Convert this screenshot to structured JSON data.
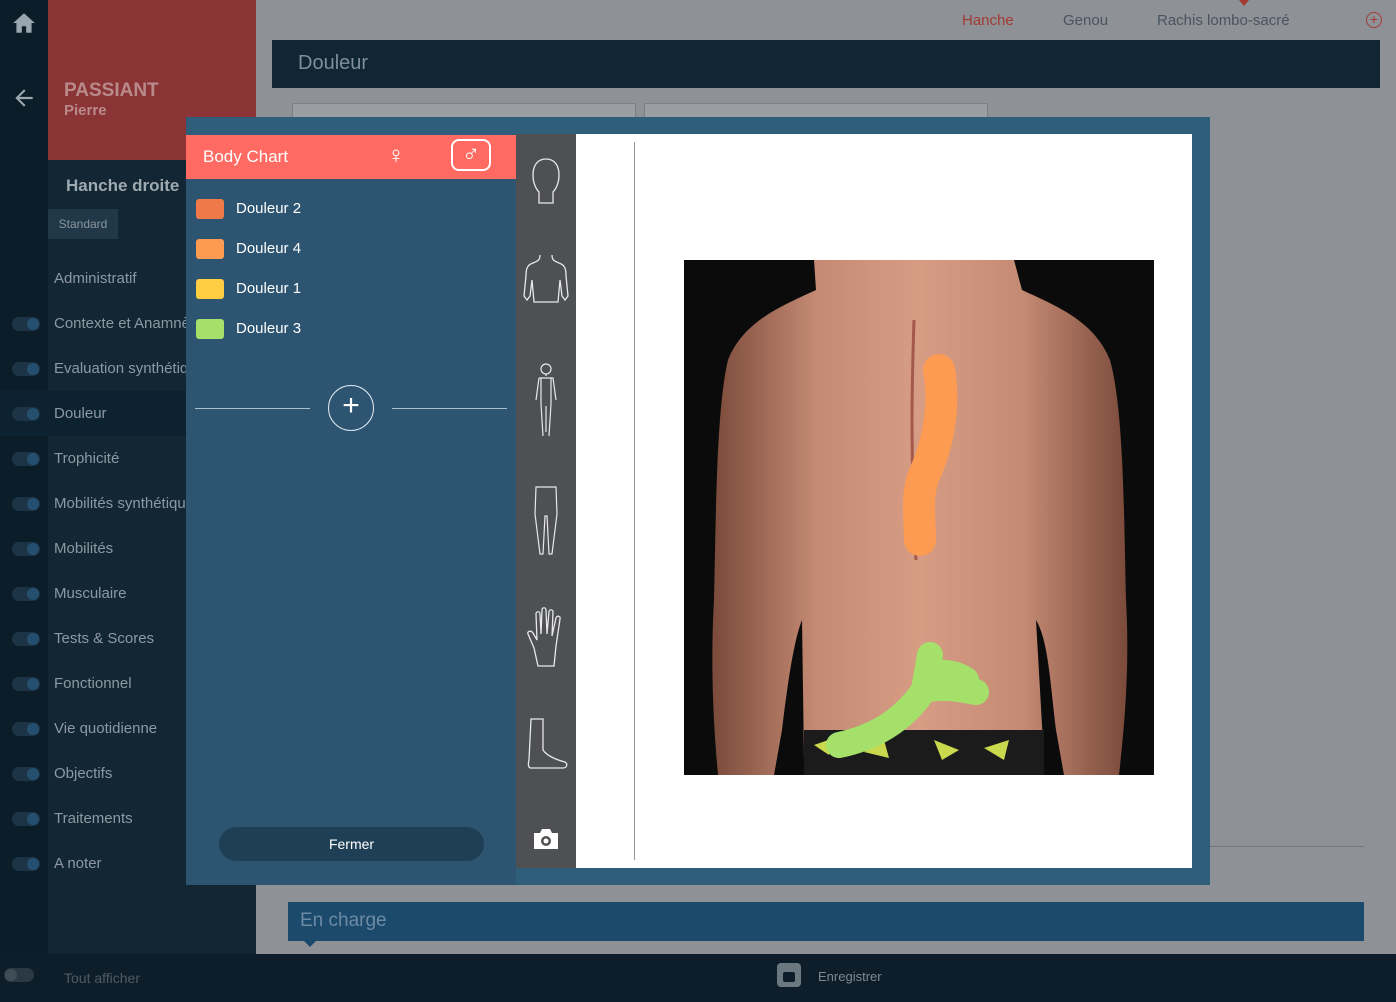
{
  "rail": {
    "home_icon": "home-icon",
    "back_icon": "arrow-left-icon"
  },
  "patient": {
    "last_name": "PASSIANT",
    "first_name": "Pierre"
  },
  "sidebar": {
    "title": "Hanche droite",
    "tab": "Standard",
    "items": [
      {
        "label": "Administratif",
        "toggle": false,
        "active": false
      },
      {
        "label": "Contexte et Anamnèse",
        "toggle": true,
        "active": false
      },
      {
        "label": "Evaluation synthétique",
        "toggle": true,
        "active": false
      },
      {
        "label": "Douleur",
        "toggle": true,
        "active": true
      },
      {
        "label": "Trophicité",
        "toggle": true,
        "active": false
      },
      {
        "label": "Mobilités synthétiques",
        "toggle": true,
        "active": false
      },
      {
        "label": "Mobilités",
        "toggle": true,
        "active": false
      },
      {
        "label": "Musculaire",
        "toggle": true,
        "active": false
      },
      {
        "label": "Tests & Scores",
        "toggle": true,
        "active": false
      },
      {
        "label": "Fonctionnel",
        "toggle": true,
        "active": false
      },
      {
        "label": "Vie quotidienne",
        "toggle": true,
        "active": false
      },
      {
        "label": "Objectifs",
        "toggle": true,
        "active": false
      },
      {
        "label": "Traitements",
        "toggle": true,
        "active": false
      },
      {
        "label": "A noter",
        "toggle": true,
        "active": false
      }
    ]
  },
  "topnav": {
    "tabs": [
      {
        "label": "Hanche",
        "active": true
      },
      {
        "label": "Genou",
        "active": false
      },
      {
        "label": "Rachis lombo-sacré",
        "active": false
      }
    ],
    "add_icon": "plus-circle-icon",
    "accent": "#a33b35"
  },
  "section": {
    "title": "Douleur"
  },
  "encharge": {
    "label": "En charge"
  },
  "bottombar": {
    "show_all": "Tout afficher",
    "save": "Enregistrer",
    "save_icon": "floppy-disk-icon"
  },
  "modal": {
    "title": "Body Chart",
    "accent": "#ff6b62",
    "female_icon": "female-symbol-icon",
    "male_icon": "male-symbol-icon",
    "pains": [
      {
        "label": "Douleur 2",
        "color": "#f0794a"
      },
      {
        "label": "Douleur 4",
        "color": "#fe9b52"
      },
      {
        "label": "Douleur 1",
        "color": "#fecd42"
      },
      {
        "label": "Douleur 3",
        "color": "#a4e06a"
      }
    ],
    "add_icon": "plus-icon",
    "close_label": "Fermer",
    "tools": [
      "head-icon",
      "torso-icon",
      "full-body-icon",
      "legs-icon",
      "hand-icon",
      "foot-icon",
      "camera-icon"
    ]
  }
}
